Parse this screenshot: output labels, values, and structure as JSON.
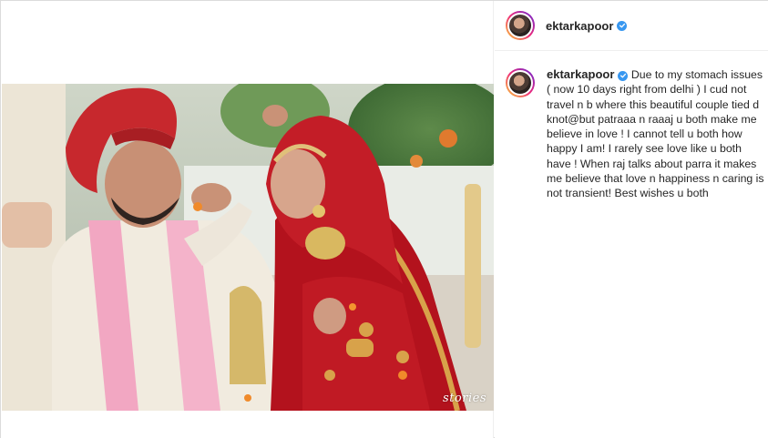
{
  "post": {
    "author": "ektarkapoor",
    "verified": true,
    "caption": "Due to my stomach issues ( now 10 days right from delhi ) I cud not travel n b where this beautiful couple tied d knot@but patraaa n raaaj u both make me believe in love ! I cannot tell u both how happy I am! I rarely see love like u both have ! When raj talks about parra it makes me believe that love n happiness n caring is not transient! Best wishes u both",
    "watermark": "stories"
  },
  "colors": {
    "verified_blue": "#3897f0",
    "border": "#dbdbdb",
    "text": "#262626"
  },
  "icons": [
    "verified-badge-icon",
    "avatar-story-ring"
  ]
}
